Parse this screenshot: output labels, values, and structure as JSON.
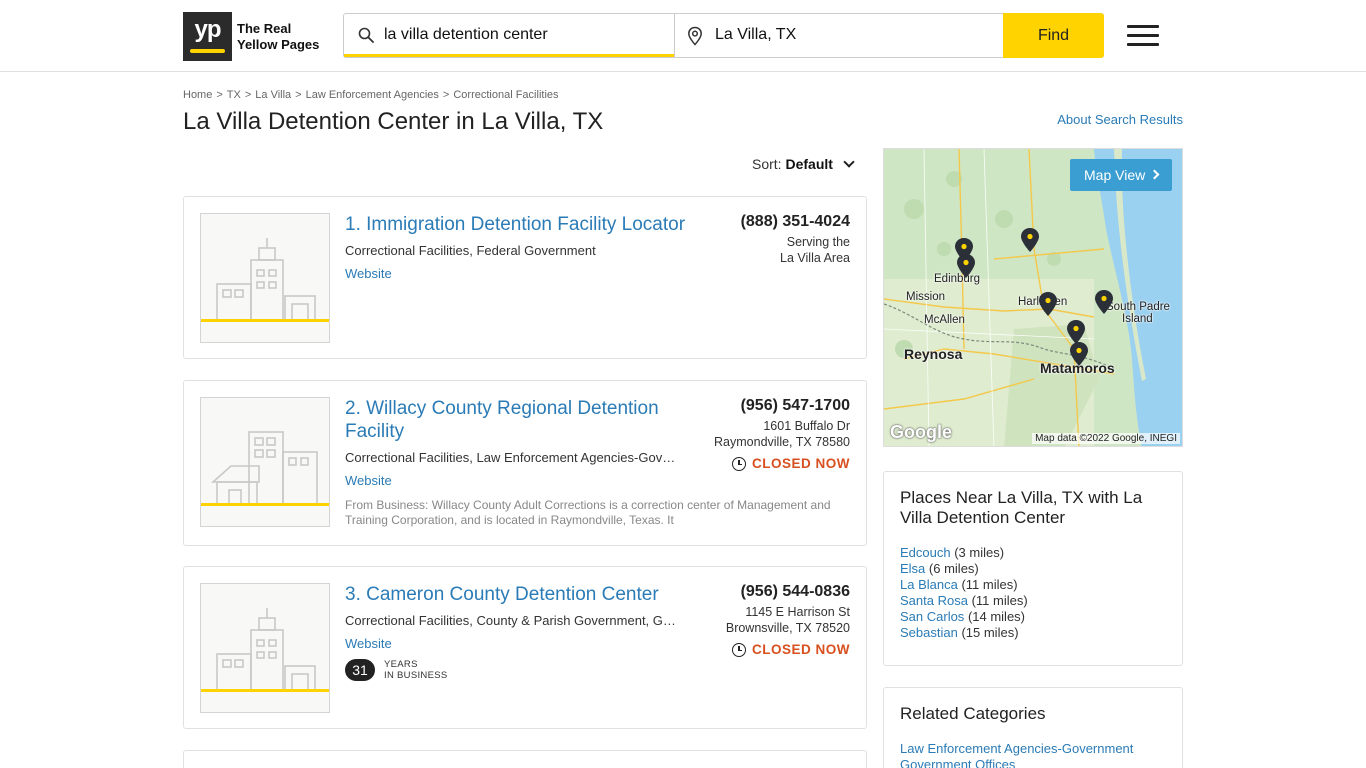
{
  "header": {
    "logo_yp": "yp",
    "logo_line1": "The Real",
    "logo_line2": "Yellow Pages",
    "search_query": "la villa detention center",
    "search_location": "La Villa, TX",
    "find_label": "Find"
  },
  "breadcrumb": {
    "items": [
      "Home",
      "TX",
      "La Villa",
      "Law Enforcement Agencies",
      "Correctional Facilities"
    ],
    "separator": ">"
  },
  "page": {
    "title": "La Villa Detention Center in La Villa, TX",
    "about_link": "About Search Results",
    "sort_label": "Sort:",
    "sort_value": "Default"
  },
  "results": [
    {
      "title": "1. Immigration Detention Facility Locator",
      "categories": "Correctional Facilities, Federal Government",
      "website": "Website",
      "phone": "(888) 351-4024",
      "address_line1": "Serving the",
      "address_line2": "La Villa Area"
    },
    {
      "title": "2. Willacy County Regional Detention Facility",
      "categories": "Correctional Facilities, Law Enforcement Agencies-Gov…",
      "website": "Website",
      "phone": "(956) 547-1700",
      "address_line1": "1601 Buffalo Dr",
      "address_line2": "Raymondville, TX 78580",
      "status": "CLOSED NOW",
      "snippet": "From Business: Willacy County Adult Corrections is a correction center of Management and Training Corporation, and is located in Raymondville, Texas. It"
    },
    {
      "title": "3. Cameron County Detention Center",
      "categories": "Correctional Facilities, County & Parish Government, G…",
      "website": "Website",
      "phone": "(956) 544-0836",
      "address_line1": "1145 E Harrison St",
      "address_line2": "Brownsville, TX 78520",
      "status": "CLOSED NOW",
      "years_number": "31",
      "years_line1": "YEARS",
      "years_line2": "IN BUSINESS"
    }
  ],
  "map": {
    "button": "Map View",
    "attribution": "Map data ©2022 Google, INEGI",
    "google": "Google",
    "labels": {
      "edinburg": "Edinburg",
      "mission": "Mission",
      "mcallen": "McAllen",
      "harlingen": "Harlingen",
      "south_padre_1": "South Padre",
      "south_padre_2": "Island",
      "reynosa": "Reynosa",
      "matamoros": "Matamoros"
    }
  },
  "places_near": {
    "title": "Places Near La Villa, TX with La Villa Detention Center",
    "items": [
      {
        "name": "Edcouch",
        "dist": "(3 miles)"
      },
      {
        "name": "Elsa",
        "dist": "(6 miles)"
      },
      {
        "name": "La Blanca",
        "dist": "(11 miles)"
      },
      {
        "name": "Santa Rosa",
        "dist": "(11 miles)"
      },
      {
        "name": "San Carlos",
        "dist": "(14 miles)"
      },
      {
        "name": "Sebastian",
        "dist": "(15 miles)"
      }
    ]
  },
  "related": {
    "title": "Related Categories",
    "items": [
      "Law Enforcement Agencies-Government",
      "Government Offices"
    ]
  },
  "colors": {
    "brand_yellow": "#fed300",
    "link_blue": "#2a7bb6",
    "closed_orange": "#d8501f",
    "map_button": "#3a9ed3"
  },
  "icons": [
    "search-icon",
    "location-pin-icon",
    "hamburger-menu-icon",
    "clock-icon",
    "chevron-down-icon",
    "chevron-right-icon",
    "map-pin-icon"
  ]
}
